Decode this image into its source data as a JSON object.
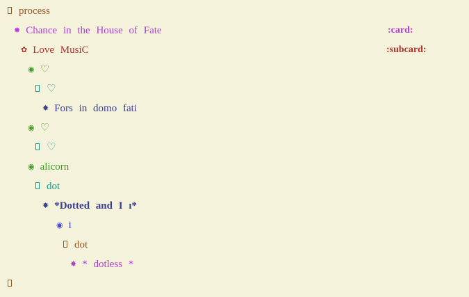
{
  "colors": {
    "background": "#f6f3dc",
    "level1": "#9a5a28",
    "level2": "#b23cd6",
    "level3": "#b0312c",
    "level4": "#3f9c2a",
    "level5": "#169a8a",
    "level6": "#3a3f92",
    "level7": "#3b3fd6"
  },
  "outline": {
    "line1": {
      "bullet": "▯",
      "text": "process"
    },
    "line2": {
      "bullet": "✸",
      "text": "Chance in the House of Fate",
      "tag": ":card:"
    },
    "line3": {
      "bullet": "✿",
      "text": "Love MusiC",
      "tag": ":subcard:"
    },
    "line4": {
      "bullet": "◉",
      "text": "♡"
    },
    "line5": {
      "bullet": "▯",
      "text": "♡"
    },
    "line6": {
      "bullet": "✸",
      "text": "Fors in domo fati"
    },
    "line7": {
      "bullet": "◉",
      "text": "♡"
    },
    "line8": {
      "bullet": "▯",
      "text": "♡"
    },
    "line9": {
      "bullet": "◉",
      "text": "alicorn"
    },
    "line10": {
      "bullet": "▯",
      "text": "dot"
    },
    "line11": {
      "bullet": "✸",
      "text": "*Dotted and I ı*"
    },
    "line12": {
      "bullet": "◉",
      "text": "i"
    },
    "line13": {
      "bullet": "▯",
      "text": "dot"
    },
    "line14": {
      "bullet": "✸",
      "text": "* dotless *"
    },
    "line15": {
      "bullet": "▯",
      "text": ""
    }
  }
}
